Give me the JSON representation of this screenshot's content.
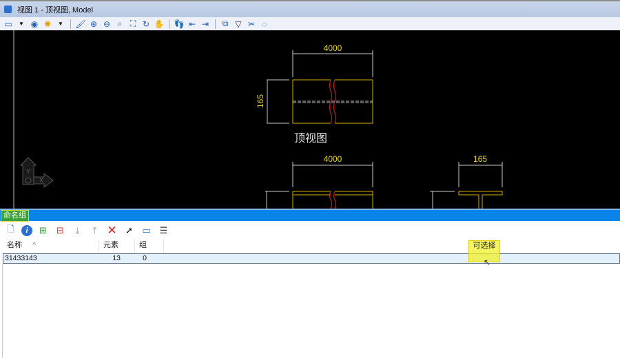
{
  "window": {
    "title": "视图 1 - 顶视图, Model"
  },
  "toolbar": {
    "icons": [
      "view-attributes-icon",
      "display-style-icon",
      "lighting-icon",
      "update-icon",
      "zoom-in-icon",
      "zoom-out-icon",
      "window-area-icon",
      "fit-view-icon",
      "rotate-icon",
      "pan-icon",
      "walk-icon",
      "previous-view-icon",
      "next-view-icon",
      "copy-view-icon",
      "view-clip-icon",
      "clip-volume-icon",
      "clip-mask-icon"
    ]
  },
  "drawing": {
    "top_view": {
      "width_dim": "4000",
      "height_dim": "165",
      "label": "顶视图"
    },
    "front_view": {
      "width_dim": "4000"
    },
    "side_view": {
      "width_dim": "165"
    },
    "axis": {
      "x": "X",
      "y": "Y"
    },
    "colors": {
      "background": "#000000",
      "outline": "#d4b000",
      "break_line": "#e02020",
      "dimension": "#c8c8c8",
      "dim_text": "#e8d800"
    }
  },
  "panel": {
    "title": "命名组",
    "tool_icons": [
      "new-group-icon",
      "info-icon",
      "add-to-group-icon",
      "remove-from-group-icon",
      "move-down-icon",
      "move-up-icon",
      "delete-icon",
      "select-group-icon",
      "view-group-icon",
      "tree-icon"
    ],
    "columns": [
      "名称",
      "元素",
      "组",
      "可选择"
    ],
    "sort_indicator": "^",
    "rows": [
      {
        "name": "31433143",
        "elements": "13",
        "groups": "0"
      }
    ]
  }
}
